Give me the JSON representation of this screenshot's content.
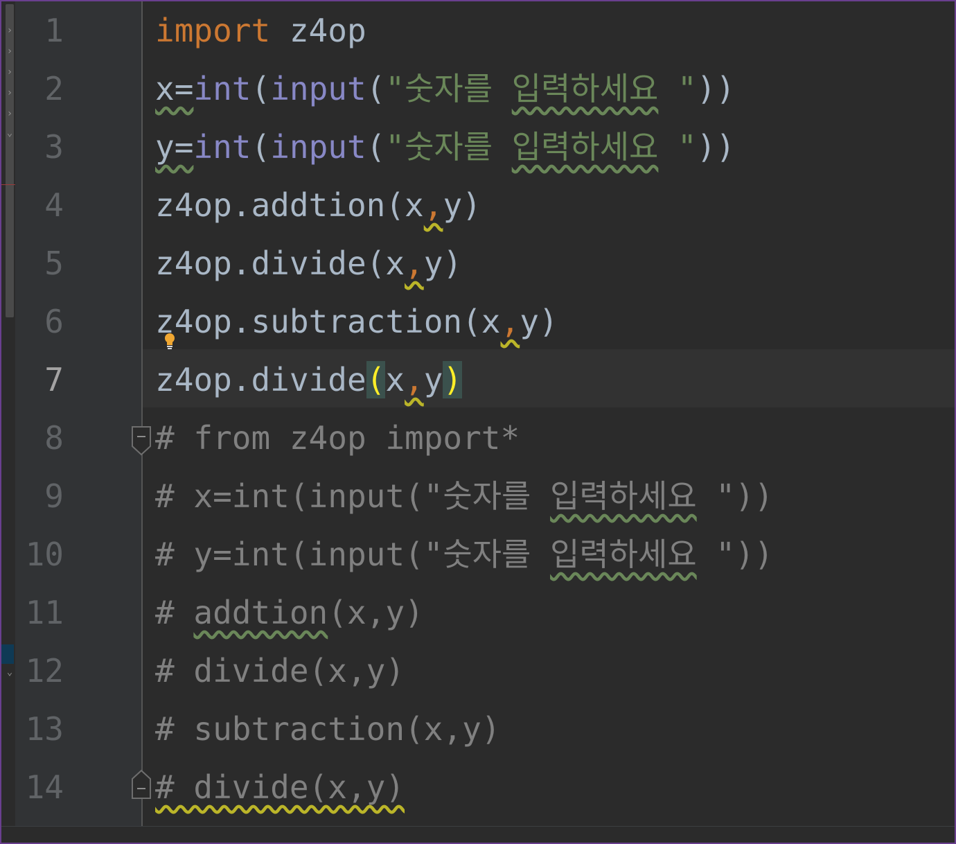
{
  "editor": {
    "line_numbers": [
      "1",
      "2",
      "3",
      "4",
      "5",
      "6",
      "7",
      "8",
      "9",
      "10",
      "11",
      "12",
      "13",
      "14"
    ],
    "current_line": "7",
    "lines": [
      {
        "kw": "import",
        "rest": " z4op"
      },
      {
        "lhs": "x=",
        "f1": "int",
        "p1": "(",
        "f2": "input",
        "p2": "(",
        "q": "\"",
        "s1": "숫자를 ",
        "s2": "입력하세요",
        "s3": " ",
        "q2": "\"",
        "close": "))"
      },
      {
        "lhs": "y=",
        "f1": "int",
        "p1": "(",
        "f2": "input",
        "p2": "(",
        "q": "\"",
        "s1": "숫자를 ",
        "s2": "입력하세요",
        "s3": " ",
        "q2": "\"",
        "close": "))"
      },
      {
        "prefix": "z4op.addtion(x",
        "comma": ",",
        "suffix": "y)"
      },
      {
        "prefix": "z4op.divide(x",
        "comma": ",",
        "suffix": "y)"
      },
      {
        "prefix": "z4op.subtraction(x",
        "comma": ",",
        "suffix": "y)"
      },
      {
        "prefix": "z4op.divide",
        "open": "(",
        "mid": "x",
        "comma": ",",
        "last": "y",
        "close": ")"
      },
      {
        "text": "# from z4op import*"
      },
      {
        "a": "# x=int(input(\"숫자를 ",
        "b": "입력하세요",
        "c": " \"))"
      },
      {
        "a": "# y=int(input(\"숫자를 ",
        "b": "입력하세요",
        "c": " \"))"
      },
      {
        "a": "# ",
        "b": "addtion",
        "c": "(x,y)"
      },
      {
        "text": "# divide(x,y)"
      },
      {
        "text": "# subtraction(x,y)"
      },
      {
        "text": "# divide(x,y)"
      }
    ]
  },
  "colors": {
    "background": "#2b2b2b",
    "gutter": "#313335",
    "keyword": "#cc7832",
    "builtin": "#8888c6",
    "string": "#6a8759",
    "comment": "#808080",
    "default": "#a9b7c6",
    "brace_match": "#ffef28",
    "window_border": "#6a3f8f"
  },
  "icons": {
    "bulb": "lightbulb-icon",
    "fold": "fold-marker-icon",
    "chevron": "chevron-right-icon"
  }
}
